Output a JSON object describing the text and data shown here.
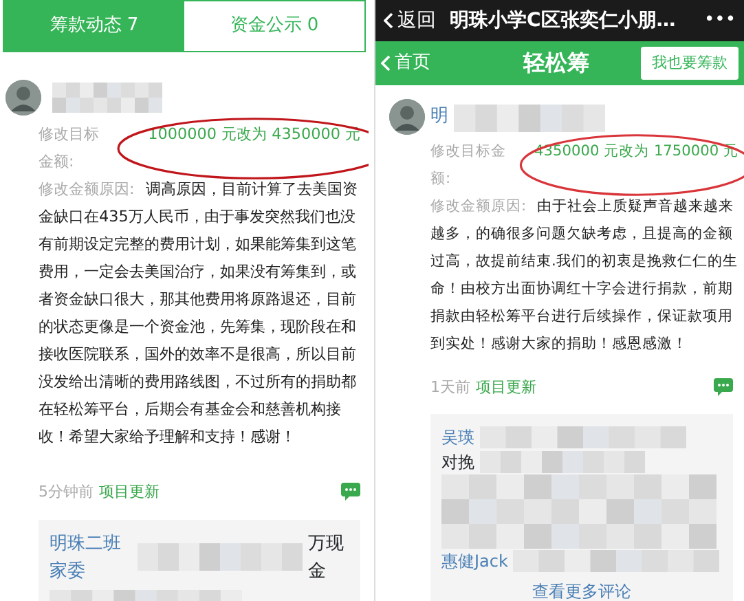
{
  "left_panel": {
    "tabs": [
      {
        "label": "筹款动态 7",
        "selected": true
      },
      {
        "label": "资金公示 0",
        "selected": false
      }
    ],
    "post": {
      "target_label": "修改目标金额:",
      "target_value": "1000000 元改为 4350000 元",
      "reason_label": "修改金额原因:",
      "reason": "调高原因，目前计算了去美国资金缺口在435万人民币，由于事发突然我们也没有前期设定完整的费用计划，如果能筹集到这笔费用，一定会去美国治疗，如果没有筹集到，或者资金缺口很大，那其他费用将原路退还，目前的状态更像是一个资金池，先筹集，现阶段在和接收医院联系，国外的效率不是很高，所以目前没发给出清晰的费用路线图，不过所有的捐助都在轻松筹平台，后期会有基金会和慈善机构接收！希望大家给予理解和支持！感谢！",
      "time": "5分钟前",
      "tag": "项目更新"
    },
    "comments": [
      {
        "kind": "name",
        "text": "明珠二班家委"
      },
      {
        "kind": "text",
        "text": "万现金"
      }
    ]
  },
  "right_panel": {
    "nav_bar": {
      "back": "返回",
      "title": "明珠小学C区张奕仁小朋…",
      "more": "•••"
    },
    "app_bar": {
      "home": "首页",
      "title": "轻松筹",
      "button": "我也要筹款"
    },
    "post": {
      "author": "明",
      "target_label": "修改目标金额:",
      "target_value": "4350000 元改为 1750000 元",
      "reason_label": "修改金额原因:",
      "reason": "由于社会上质疑声音越来越来越多，的确很多问题欠缺考虑，且提高的金额过高，故提前结束.我们的初衷是挽救仁仁的生命！由校方出面协调红十字会进行捐款，前期捐款由轻松筹平台进行后续操作，保证款项用到实处！感谢大家的捐助！感恩感激！",
      "time": "1天前",
      "tag": "项目更新"
    },
    "comments": [
      {
        "kind": "name",
        "text": "吴瑛"
      },
      {
        "kind": "text",
        "text": "对挽"
      },
      {
        "kind": "name",
        "text": "惠健Jack"
      }
    ],
    "more_comments": "查看更多评论"
  }
}
